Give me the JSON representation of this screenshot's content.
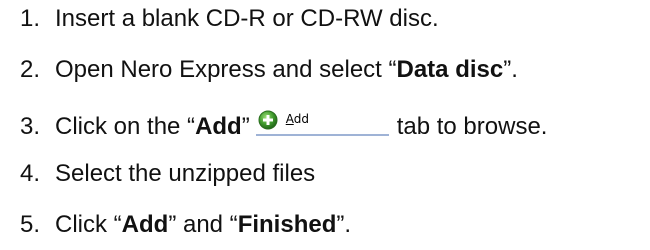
{
  "steps": [
    {
      "number": "1.",
      "text": "Insert a blank CD-R or CD-RW disc."
    },
    {
      "number": "2.",
      "text_before": "Open Nero Express and select “",
      "bold": "Data disc",
      "text_after": "”."
    },
    {
      "number": "3.",
      "text_before": "Click on the “",
      "bold": "Add",
      "text_after_bold": "”",
      "inline_button": {
        "icon": "green-plus-icon",
        "accelerator_letter": "A",
        "label_rest": "dd"
      },
      "text_after": "tab to browse."
    },
    {
      "number": "4.",
      "text": "Select the unzipped files"
    },
    {
      "number": "5.",
      "text_before": "Click “",
      "bold1": "Add",
      "text_middle": "” and “",
      "bold2": "Finished",
      "text_after": "”."
    }
  ],
  "colors": {
    "text": "#111111",
    "icon_green": "#3f9a2c",
    "tab_underline": "#9fb3d6"
  }
}
